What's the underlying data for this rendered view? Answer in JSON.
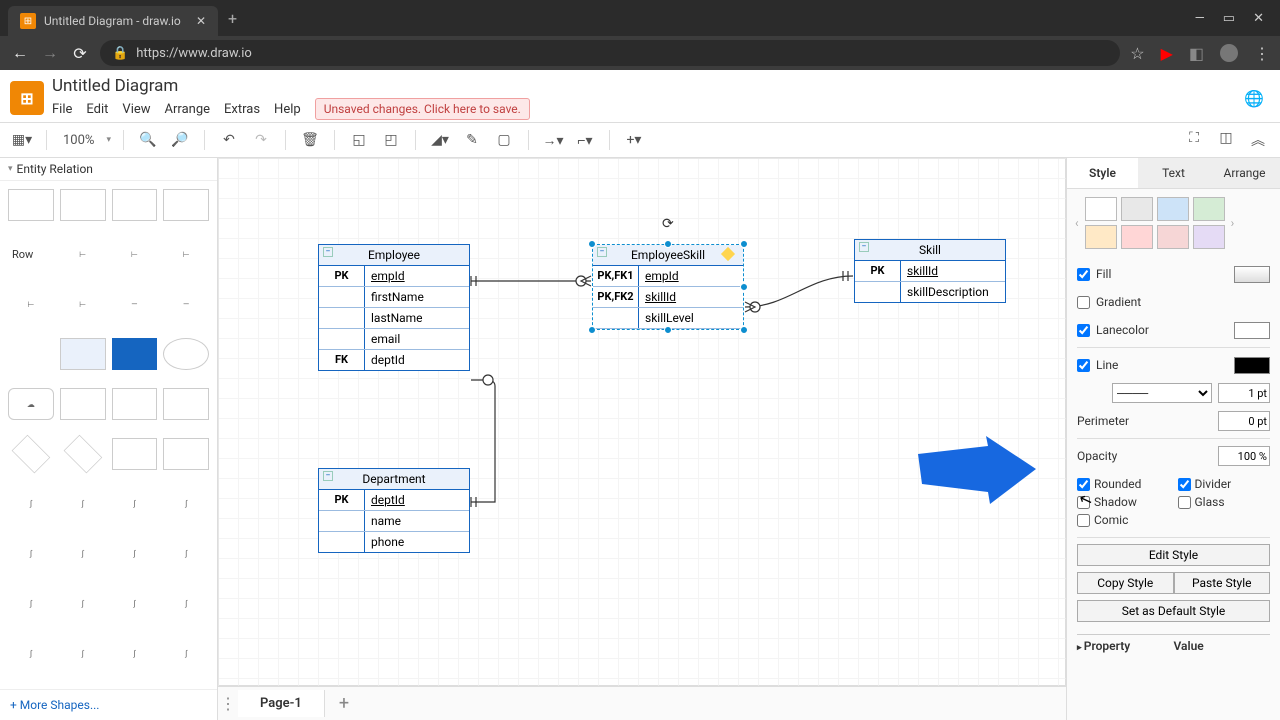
{
  "browser": {
    "tab_title": "Untitled Diagram - draw.io",
    "url": "https://www.draw.io"
  },
  "app": {
    "doc_title": "Untitled Diagram",
    "menus": [
      "File",
      "Edit",
      "View",
      "Arrange",
      "Extras",
      "Help"
    ],
    "unsaved_msg": "Unsaved changes. Click here to save."
  },
  "toolbar": {
    "zoom": "100%"
  },
  "sidebar": {
    "section": "Entity Relation",
    "row_label": "Row",
    "more": "+ More Shapes..."
  },
  "canvas": {
    "employee": {
      "title": "Employee",
      "rows": [
        {
          "k": "PK",
          "f": "empId",
          "u": true
        },
        {
          "k": "",
          "f": "firstName"
        },
        {
          "k": "",
          "f": "lastName"
        },
        {
          "k": "",
          "f": "email"
        },
        {
          "k": "FK",
          "f": "deptId"
        }
      ]
    },
    "empskill": {
      "title": "EmployeeSkill",
      "rows": [
        {
          "k": "PK,FK1",
          "f": "empId",
          "u": true
        },
        {
          "k": "PK,FK2",
          "f": "skillId",
          "u": true
        },
        {
          "k": "",
          "f": "skillLevel"
        }
      ]
    },
    "skill": {
      "title": "Skill",
      "rows": [
        {
          "k": "PK",
          "f": "skillId",
          "u": true
        },
        {
          "k": "",
          "f": "skillDescription"
        }
      ]
    },
    "dept": {
      "title": "Department",
      "rows": [
        {
          "k": "PK",
          "f": "deptId",
          "u": true
        },
        {
          "k": "",
          "f": "name"
        },
        {
          "k": "",
          "f": "phone"
        }
      ]
    }
  },
  "pages": {
    "p1": "Page-1"
  },
  "right": {
    "tabs": [
      "Style",
      "Text",
      "Arrange"
    ],
    "swatches": [
      "#ffffff",
      "#e8e8e8",
      "#cde3f8",
      "#d5ecd5",
      "#ffe9c6",
      "#ffd6d6",
      "#f6d6d6",
      "#e5dbf5"
    ],
    "fill": "Fill",
    "gradient": "Gradient",
    "lanecolor": "Lanecolor",
    "line": "Line",
    "line_pt": "1 pt",
    "perimeter": "Perimeter",
    "perimeter_pt": "0 pt",
    "opacity": "Opacity",
    "opacity_val": "100 %",
    "rounded": "Rounded",
    "divider": "Divider",
    "shadow": "Shadow",
    "glass": "Glass",
    "comic": "Comic",
    "edit_style": "Edit Style",
    "copy_style": "Copy Style",
    "paste_style": "Paste Style",
    "default_style": "Set as Default Style",
    "property": "Property",
    "value": "Value"
  }
}
